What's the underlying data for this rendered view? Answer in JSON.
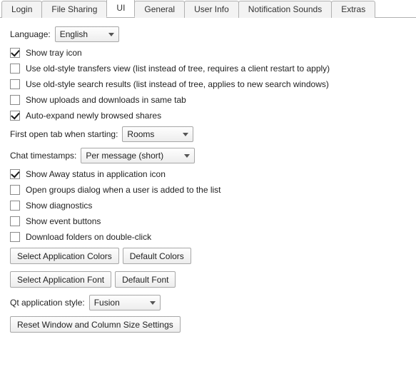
{
  "tabs": [
    {
      "label": "Login"
    },
    {
      "label": "File Sharing"
    },
    {
      "label": "UI",
      "active": true
    },
    {
      "label": "General"
    },
    {
      "label": "User Info"
    },
    {
      "label": "Notification Sounds"
    },
    {
      "label": "Extras"
    }
  ],
  "language": {
    "label": "Language:",
    "value": "English"
  },
  "checks": {
    "tray": {
      "label": "Show tray icon",
      "checked": true
    },
    "oldTransfers": {
      "label": "Use old-style transfers view (list instead of tree, requires a client restart to apply)",
      "checked": false
    },
    "oldSearch": {
      "label": "Use old-style search results (list instead of tree, applies to new search windows)",
      "checked": false
    },
    "sameTab": {
      "label": "Show uploads and downloads in same tab",
      "checked": false
    },
    "autoExpand": {
      "label": "Auto-expand newly browsed shares",
      "checked": true
    },
    "awayIcon": {
      "label": "Show Away status in application icon",
      "checked": true
    },
    "groupsDialog": {
      "label": "Open groups dialog when a user is added to the list",
      "checked": false
    },
    "diagnostics": {
      "label": "Show diagnostics",
      "checked": false
    },
    "eventButtons": {
      "label": "Show event buttons",
      "checked": false
    },
    "dlDblClick": {
      "label": "Download folders on double-click",
      "checked": false
    }
  },
  "firstTab": {
    "label": "First open tab when starting:",
    "value": "Rooms"
  },
  "timestamps": {
    "label": "Chat timestamps:",
    "value": "Per message (short)"
  },
  "buttons": {
    "selectColors": "Select Application Colors",
    "defaultColors": "Default Colors",
    "selectFont": "Select Application Font",
    "defaultFont": "Default Font",
    "resetSizes": "Reset Window and Column Size Settings"
  },
  "qtStyle": {
    "label": "Qt application style:",
    "value": "Fusion"
  }
}
